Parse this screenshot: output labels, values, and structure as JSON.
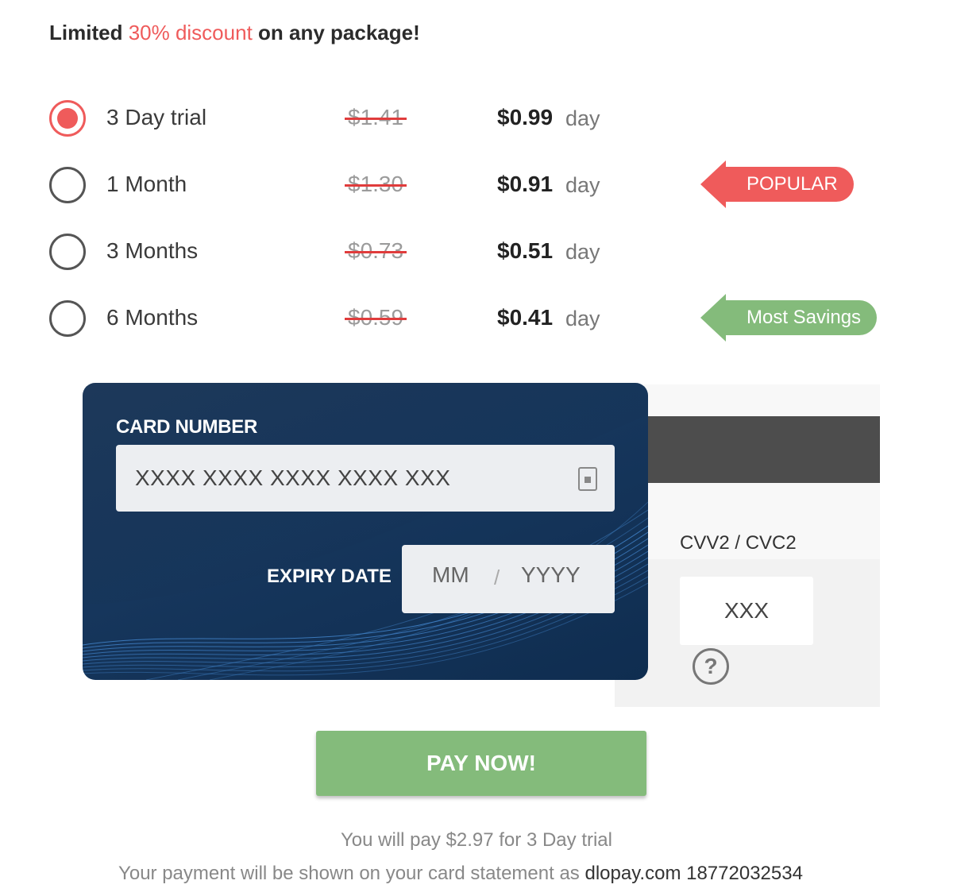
{
  "promo": {
    "prefix": "Limited",
    "highlight": "30% discount",
    "suffix": "on any package!",
    "highlight_color": "#ef5b5b"
  },
  "plans": [
    {
      "name": "3 Day trial",
      "old_price": "$1.41",
      "price": "$0.99",
      "per": "day",
      "selected": true,
      "tag": ""
    },
    {
      "name": "1 Month",
      "old_price": "$1.30",
      "price": "$0.91",
      "per": "day",
      "selected": false,
      "tag": "POPULAR"
    },
    {
      "name": "3 Months",
      "old_price": "$0.73",
      "price": "$0.51",
      "per": "day",
      "selected": false,
      "tag": ""
    },
    {
      "name": "6 Months",
      "old_price": "$0.59",
      "price": "$0.41",
      "per": "day",
      "selected": false,
      "tag": "Most Savings"
    }
  ],
  "card": {
    "number_label": "CARD NUMBER",
    "number_placeholder": "XXXX XXXX XXXX XXXX XXX",
    "expiry_label": "EXPIRY DATE",
    "month_placeholder": "MM",
    "separator": "/",
    "year_placeholder": "YYYY",
    "cvv_label": "CVV2 / CVC2",
    "cvv_placeholder": "XXX",
    "help_symbol": "?"
  },
  "pay_button": "PAY NOW!",
  "summary": {
    "prefix": "You will pay",
    "amount": "$2.97",
    "middle": "for",
    "plan": "3 Day trial"
  },
  "statement": {
    "prefix": "Your payment will be shown on your card statement as",
    "descriptor": "dlopay.com 18772032534"
  },
  "colors": {
    "accent_red": "#ef5b5b",
    "accent_green": "#84bb7b",
    "card_blue": "#16365c"
  }
}
